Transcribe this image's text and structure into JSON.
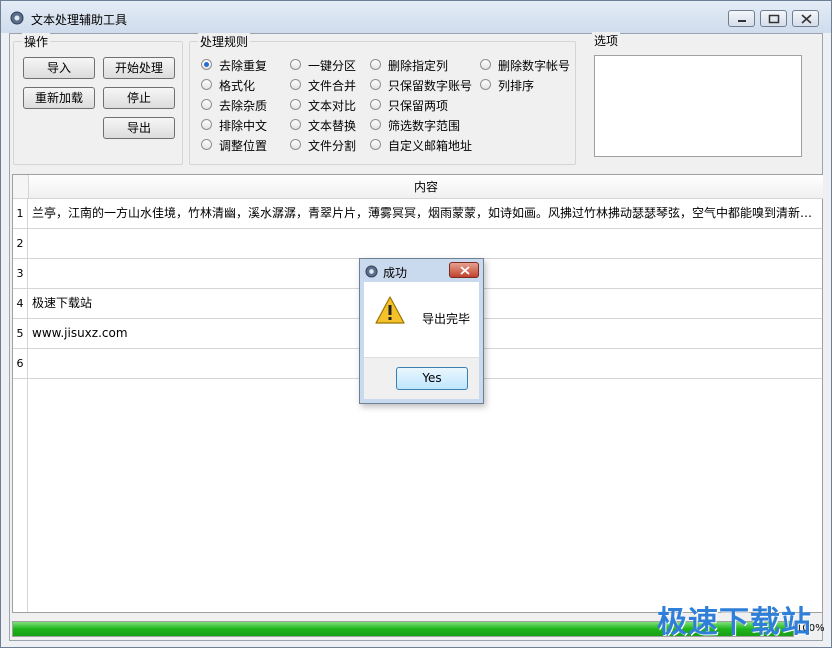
{
  "window": {
    "title": "文本处理辅助工具"
  },
  "operations": {
    "title": "操作",
    "buttons": [
      "导入",
      "开始处理",
      "重新加载",
      "停止",
      "导出"
    ]
  },
  "rules": {
    "title": "处理规则",
    "selected": "去除重复",
    "columns": [
      [
        "去除重复",
        "格式化",
        "去除杂质",
        "排除中文",
        "调整位置"
      ],
      [
        "一键分区",
        "文件合并",
        "文本对比",
        "文本替换",
        "文件分割"
      ],
      [
        "删除指定列",
        "只保留数字账号",
        "只保留两项",
        "筛选数字范围",
        "自定义邮箱地址"
      ],
      [
        "删除数字帐号",
        "列排序"
      ]
    ]
  },
  "options": {
    "title": "选项"
  },
  "grid": {
    "header": "内容",
    "rows": [
      {
        "num": "1",
        "text": "兰亭，江南的一方山水佳境，竹林清幽，溪水潺潺，青翠片片，薄雾冥冥，烟雨蒙蒙，如诗如画。风拂过竹林拂动瑟瑟琴弦，空气中都能嗅到清新的气息"
      },
      {
        "num": "2",
        "text": ""
      },
      {
        "num": "3",
        "text": ""
      },
      {
        "num": "4",
        "text": "极速下载站"
      },
      {
        "num": "5",
        "text": "www.jisuxz.com"
      },
      {
        "num": "6",
        "text": ""
      }
    ]
  },
  "progress": {
    "percent": 100,
    "label": "100%"
  },
  "watermark": "极速下载站",
  "dialog": {
    "title": "成功",
    "message": "导出完毕",
    "button": "Yes"
  },
  "icons": [
    "app-icon",
    "minimize-icon",
    "maximize-icon",
    "close-icon",
    "warning-icon",
    "dialog-close-icon"
  ]
}
